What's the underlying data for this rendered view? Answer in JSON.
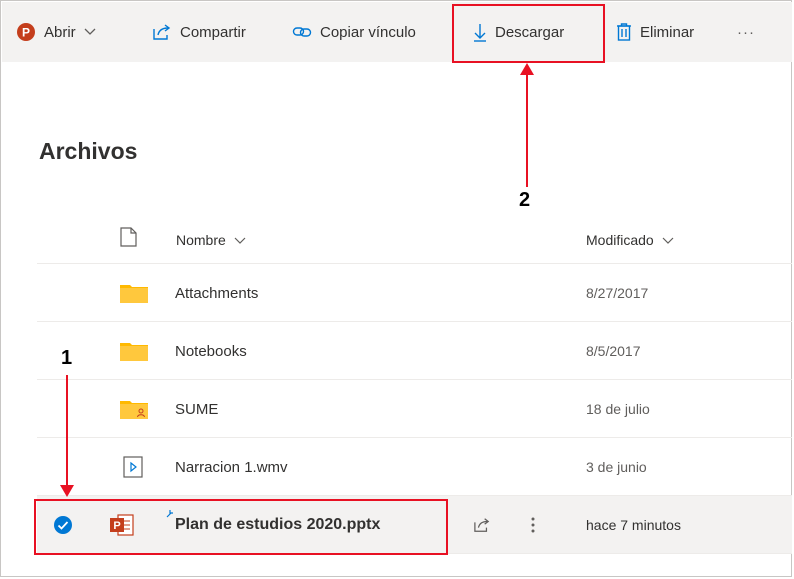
{
  "toolbar": {
    "open_label": "Abrir",
    "share_label": "Compartir",
    "copy_link_label": "Copiar vínculo",
    "download_label": "Descargar",
    "delete_label": "Eliminar",
    "more_label": "···"
  },
  "page": {
    "title": "Archivos"
  },
  "columns": {
    "name": "Nombre",
    "modified": "Modificado"
  },
  "files": [
    {
      "name": "Attachments",
      "modified": "8/27/2017",
      "icon": "folder-icon"
    },
    {
      "name": "Notebooks",
      "modified": "8/5/2017",
      "icon": "folder-icon"
    },
    {
      "name": "SUME",
      "modified": "18 de julio",
      "icon": "shared-folder-icon"
    },
    {
      "name": "Narracion 1.wmv",
      "modified": "3 de junio",
      "icon": "video-file-icon"
    },
    {
      "name": "Plan de estudios 2020.pptx",
      "modified": "hace 7 minutos",
      "icon": "powerpoint-file-icon",
      "selected": true
    }
  ],
  "annotations": {
    "step1": "1",
    "step2": "2"
  },
  "colors": {
    "accent": "#0078d4",
    "powerpoint": "#c43e1c",
    "folder": "#ffb900",
    "callout": "#e81123"
  }
}
